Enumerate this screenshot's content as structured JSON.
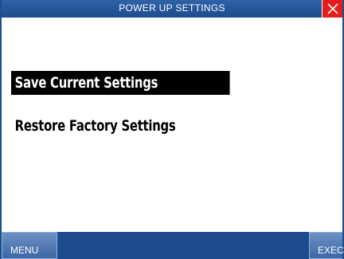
{
  "header": {
    "title": "POWER UP SETTINGS",
    "close_icon": "close-x-icon",
    "close_color": "#e51d1d"
  },
  "options": [
    {
      "label": "Save Current Settings",
      "selected": true
    },
    {
      "label": "Restore Factory Settings",
      "selected": false
    }
  ],
  "footer": {
    "menu_label": "MENU",
    "exec_label": "EXEC"
  },
  "colors": {
    "bar": "#1d4c8e",
    "selection": "#000000"
  }
}
